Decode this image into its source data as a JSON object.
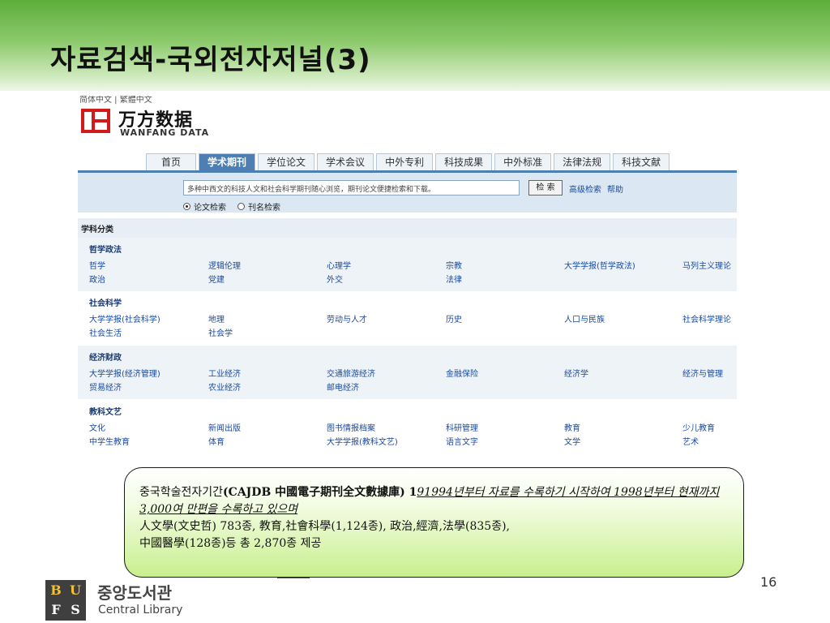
{
  "slide": {
    "title": "자료검색-국외전자저널(3)",
    "page_number": "16",
    "accent_color": "#5dae3c"
  },
  "screenshot": {
    "lang_links": "简体中文 | 繁體中文",
    "logo_cn": "万方数据",
    "logo_en": "WANFANG DATA",
    "tabs": [
      "首页",
      "学术期刊",
      "学位论文",
      "学术会议",
      "中外专利",
      "科技成果",
      "中外标准",
      "法律法规",
      "科技文献"
    ],
    "active_tab": "学术期刊",
    "search": {
      "placeholder": "多种中西文的科技人文和社会科学期刊随心浏览，期刊论文便捷检索和下载。",
      "button": "检 索",
      "advanced": "高级检索",
      "help": "帮助",
      "radio_options": [
        "论文检索",
        "刊名检索"
      ],
      "selected": "论文检索"
    },
    "subject_header": "学科分类",
    "categories": [
      {
        "title": "哲学政法",
        "rows": [
          [
            "哲学",
            "逻辑伦理",
            "心理学",
            "宗教",
            "大学学报(哲学政法)",
            "马列主义理论"
          ],
          [
            "政治",
            "党建",
            "外交",
            "法律",
            "",
            ""
          ]
        ]
      },
      {
        "title": "社会科学",
        "rows": [
          [
            "大学学报(社会科学)",
            "地理",
            "劳动与人才",
            "历史",
            "人口与民族",
            "社会科学理论"
          ],
          [
            "社会生活",
            "社会学",
            "",
            "",
            "",
            ""
          ]
        ]
      },
      {
        "title": "经济财政",
        "rows": [
          [
            "大学学报(经济管理)",
            "工业经济",
            "交通旅游经济",
            "金融保险",
            "经济学",
            "经济与管理"
          ],
          [
            "贸易经济",
            "农业经济",
            "邮电经济",
            "",
            "",
            ""
          ]
        ]
      },
      {
        "title": "教科文艺",
        "rows": [
          [
            "文化",
            "新闻出版",
            "图书情报档案",
            "科研管理",
            "教育",
            "少儿教育"
          ],
          [
            "中学生教育",
            "体育",
            "大学学报(教科文艺)",
            "语言文字",
            "文学",
            "艺术"
          ]
        ]
      }
    ]
  },
  "callout": {
    "seg1": "중국학술전자기간",
    "seg2": "(CAJDB 中國電子期刊全文數據庫) 1",
    "seg3": "91994년부터 자료를 수록하기 시작하여 1998년부터 현재까지 3,000여 만편을 수록하고 있으며",
    "seg4": "人文學(文史哲) 783종, 教育,社會科學(1,124종), 政治,經濟,法學(835종),",
    "seg5": "中國醫學(128종)등 총 2,870종 제공"
  },
  "footer": {
    "logo_letters": [
      "B",
      "U",
      "F",
      "S"
    ],
    "library_kr": "중앙도서관",
    "library_en": "Central Library"
  }
}
